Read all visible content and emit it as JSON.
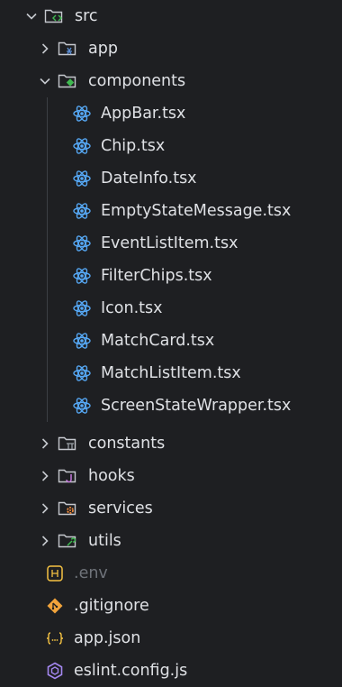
{
  "explorer": {
    "root": {
      "label": "src",
      "expanded": true,
      "icon": "folder-src-icon"
    },
    "items": [
      {
        "label": "app",
        "kind": "folder",
        "expanded": false,
        "icon": "folder-app-icon",
        "accent": "#5c8fd6"
      },
      {
        "label": "components",
        "kind": "folder",
        "expanded": true,
        "icon": "folder-components-icon",
        "accent": "#3fb950"
      },
      {
        "label": "AppBar.tsx",
        "kind": "file",
        "icon": "react-icon"
      },
      {
        "label": "Chip.tsx",
        "kind": "file",
        "icon": "react-icon"
      },
      {
        "label": "DateInfo.tsx",
        "kind": "file",
        "icon": "react-icon"
      },
      {
        "label": "EmptyStateMessage.tsx",
        "kind": "file",
        "icon": "react-icon"
      },
      {
        "label": "EventListItem.tsx",
        "kind": "file",
        "icon": "react-icon"
      },
      {
        "label": "FilterChips.tsx",
        "kind": "file",
        "icon": "react-icon"
      },
      {
        "label": "Icon.tsx",
        "kind": "file",
        "icon": "react-icon"
      },
      {
        "label": "MatchCard.tsx",
        "kind": "file",
        "icon": "react-icon"
      },
      {
        "label": "MatchListItem.tsx",
        "kind": "file",
        "icon": "react-icon"
      },
      {
        "label": "ScreenStateWrapper.tsx",
        "kind": "file",
        "icon": "react-icon"
      },
      {
        "label": "constants",
        "kind": "folder",
        "expanded": false,
        "icon": "folder-constants-icon",
        "accent": "#9aa0a6"
      },
      {
        "label": "hooks",
        "kind": "folder",
        "expanded": false,
        "icon": "folder-hooks-icon",
        "accent": "#c678dd"
      },
      {
        "label": "services",
        "kind": "folder",
        "expanded": false,
        "icon": "folder-services-icon",
        "accent": "#f28b3c"
      },
      {
        "label": "utils",
        "kind": "folder",
        "expanded": false,
        "icon": "folder-utils-icon",
        "accent": "#3fb950"
      },
      {
        "label": ".env",
        "kind": "file",
        "icon": "env-icon",
        "dimmed": true
      },
      {
        "label": ".gitignore",
        "kind": "file",
        "icon": "git-icon"
      },
      {
        "label": "app.json",
        "kind": "file",
        "icon": "json-icon"
      },
      {
        "label": "eslint.config.js",
        "kind": "file",
        "icon": "eslint-icon"
      }
    ]
  },
  "colors": {
    "background": "#1e1f22",
    "text": "#dfe1e5",
    "react": "#56a8f5",
    "git": "#f1a33b",
    "json": "#f5c242",
    "eslint": "#a487f0"
  }
}
